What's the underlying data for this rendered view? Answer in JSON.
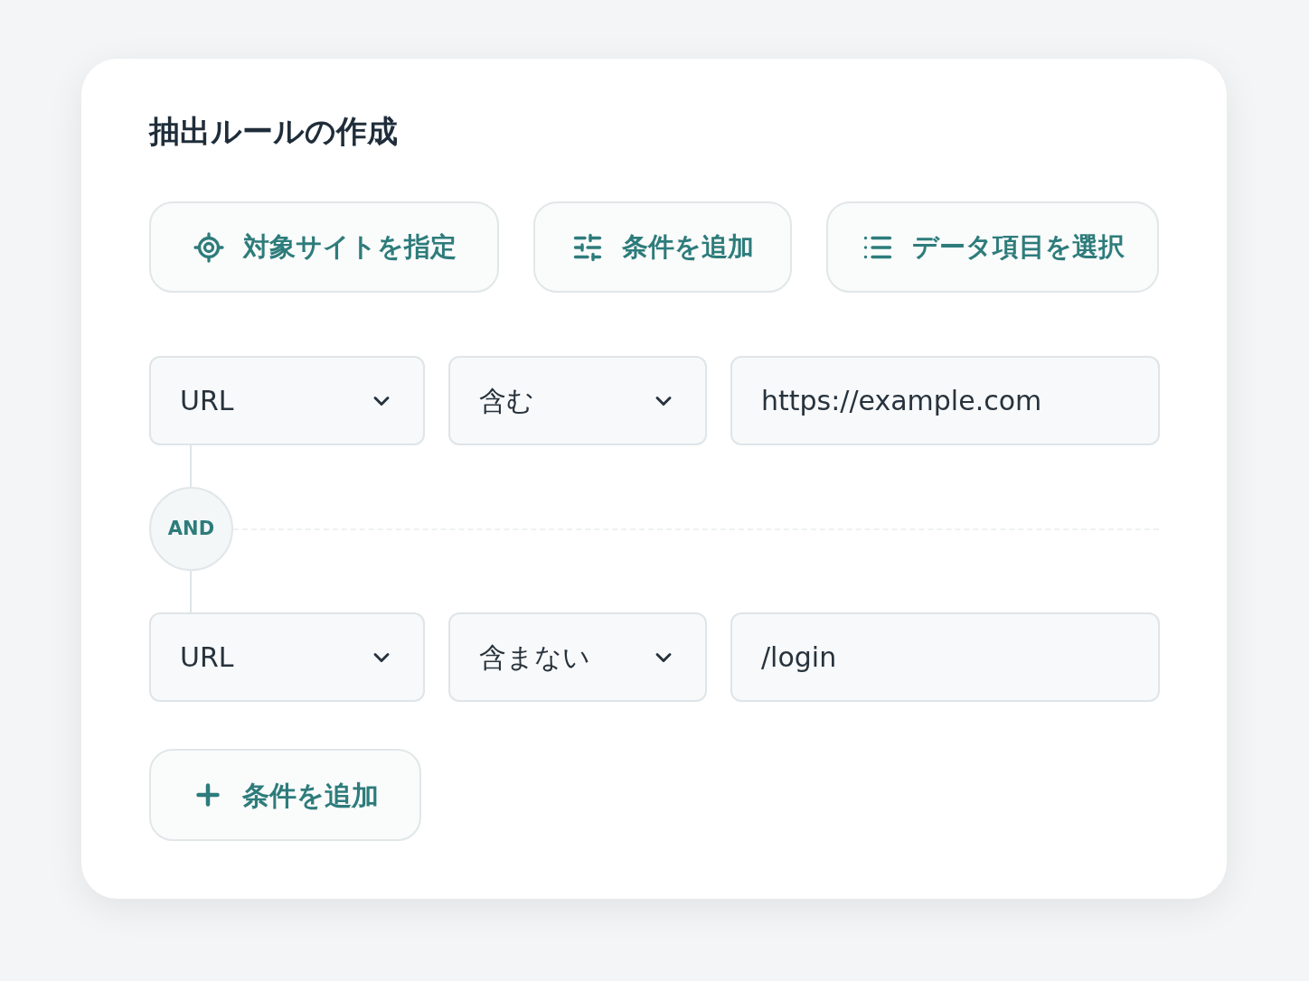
{
  "title": "抽出ルールの作成",
  "actions": [
    {
      "label": "対象サイトを指定"
    },
    {
      "label": "条件を追加"
    },
    {
      "label": "データ項目を選択"
    }
  ],
  "conditions": [
    {
      "field": "URL",
      "operator": "含む",
      "value": "https://example.com"
    },
    {
      "field": "URL",
      "operator": "含まない",
      "value": "/login"
    }
  ],
  "connector": "AND",
  "add_button": "条件を追加"
}
